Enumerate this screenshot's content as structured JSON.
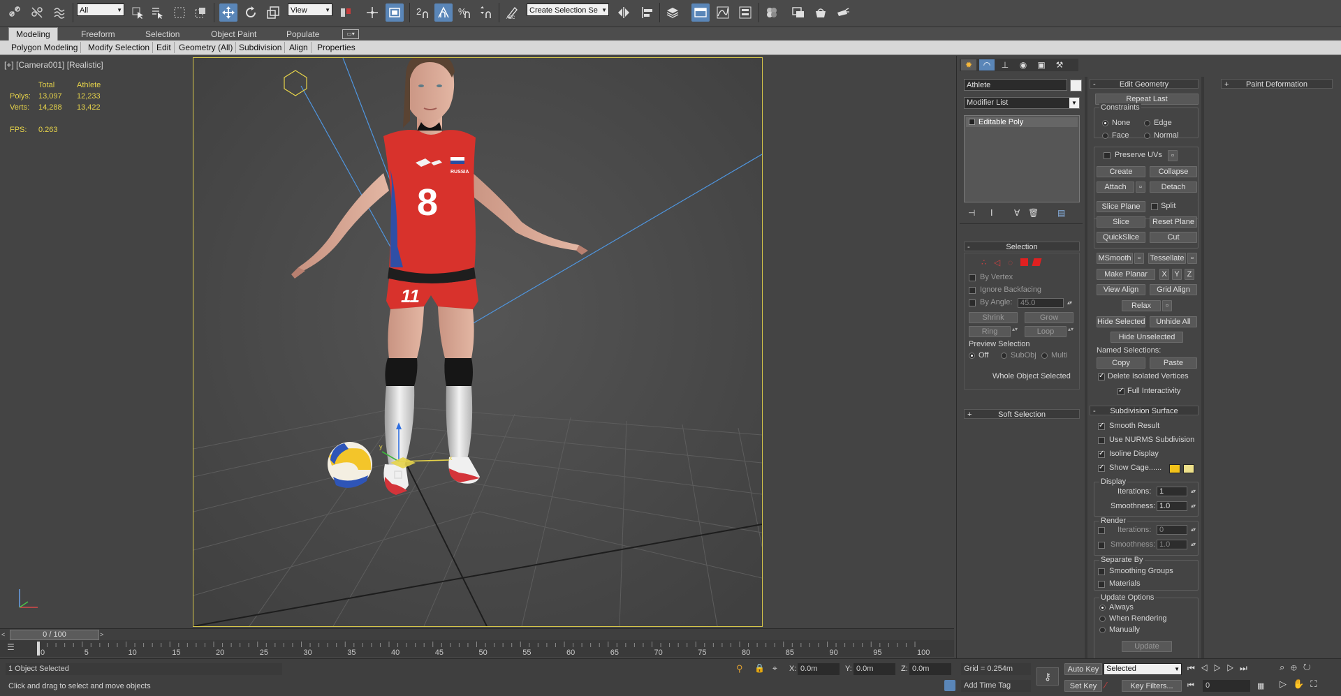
{
  "toolbar": {
    "selection_filter": "All",
    "ref_coord": "View",
    "named_selection_placeholder": "Create Selection Se",
    "snap_label": "2",
    "percent_snap": "%",
    "spinner_snap": "n"
  },
  "ribbon": {
    "tabs": [
      "Modeling",
      "Freeform",
      "Selection",
      "Object Paint",
      "Populate"
    ],
    "sub_tabs": [
      "Polygon Modeling",
      "Modify Selection",
      "Edit",
      "Geometry (All)",
      "Subdivision",
      "Align",
      "Properties"
    ]
  },
  "viewport": {
    "label": "[+] [Camera001] [Realistic]",
    "stats": {
      "col_total": "Total",
      "col_object": "Athlete",
      "polys_label": "Polys:",
      "polys_total": "13,097",
      "polys_object": "12,233",
      "verts_label": "Verts:",
      "verts_total": "14,288",
      "verts_object": "13,422",
      "fps_label": "FPS:",
      "fps_value": "0.263"
    },
    "jersey_text": "RUSSIA",
    "jersey_number": "8",
    "shorts_number": "11",
    "axis_x": "x",
    "axis_y": "y"
  },
  "command_panel": {
    "object_name": "Athlete",
    "modifier_list": "Modifier List",
    "stack_item": "Editable Poly",
    "selection": {
      "title": "Selection",
      "by_vertex": "By Vertex",
      "ignore_backfacing": "Ignore Backfacing",
      "by_angle": "By Angle:",
      "angle_value": "45.0",
      "shrink": "Shrink",
      "grow": "Grow",
      "ring": "Ring",
      "loop": "Loop",
      "preview_title": "Preview Selection",
      "preview_off": "Off",
      "preview_subobj": "SubObj",
      "preview_multi": "Multi",
      "status": "Whole Object Selected"
    },
    "soft_selection": "Soft Selection",
    "edit_geometry": {
      "title": "Edit Geometry",
      "repeat_last": "Repeat Last",
      "constraints": "Constraints",
      "c_none": "None",
      "c_edge": "Edge",
      "c_face": "Face",
      "c_normal": "Normal",
      "preserve_uvs": "Preserve UVs",
      "create": "Create",
      "collapse": "Collapse",
      "attach": "Attach",
      "detach": "Detach",
      "slice_plane": "Slice Plane",
      "split": "Split",
      "slice": "Slice",
      "reset_plane": "Reset Plane",
      "quickslice": "QuickSlice",
      "cut": "Cut",
      "msmooth": "MSmooth",
      "tessellate": "Tessellate",
      "make_planar": "Make Planar",
      "x": "X",
      "y": "Y",
      "z": "Z",
      "view_align": "View Align",
      "grid_align": "Grid Align",
      "relax": "Relax",
      "hide_selected": "Hide Selected",
      "unhide_all": "Unhide All",
      "hide_unselected": "Hide Unselected",
      "named_selections": "Named Selections:",
      "copy": "Copy",
      "paste": "Paste",
      "delete_isolated": "Delete Isolated Vertices",
      "full_interactivity": "Full Interactivity"
    },
    "subdivision": {
      "title": "Subdivision Surface",
      "smooth_result": "Smooth Result",
      "use_nurms": "Use NURMS Subdivision",
      "isoline": "Isoline Display",
      "show_cage": "Show Cage......",
      "cage_color_1": "#f2c21a",
      "cage_color_2": "#ede08a",
      "display": "Display",
      "iterations": "Iterations:",
      "iterations_val": "1",
      "smoothness": "Smoothness:",
      "smoothness_val": "1.0",
      "render": "Render",
      "r_iterations_val": "0",
      "r_smoothness_val": "1.0",
      "separate_by": "Separate By",
      "smoothing_groups": "Smoothing Groups",
      "materials": "Materials",
      "update_options": "Update Options",
      "always": "Always",
      "when_rendering": "When Rendering",
      "manually": "Manually",
      "update": "Update"
    },
    "paint_deformation": "Paint Deformation"
  },
  "timeline": {
    "frame": "0 / 100",
    "ticks": [
      "0",
      "5",
      "10",
      "15",
      "20",
      "25",
      "30",
      "35",
      "40",
      "45",
      "50",
      "55",
      "60",
      "65",
      "70",
      "75",
      "80",
      "85",
      "90",
      "95",
      "100"
    ]
  },
  "status": {
    "selected": "1 Object Selected",
    "prompt": "Click and drag to select and move objects",
    "x_label": "X:",
    "x_val": "0.0m",
    "y_label": "Y:",
    "y_val": "0.0m",
    "z_label": "Z:",
    "z_val": "0.0m",
    "grid": "Grid = 0.254m",
    "add_time_tag": "Add Time Tag",
    "auto_key": "Auto Key",
    "set_key": "Set Key",
    "key_mode": "Selected",
    "key_filters": "Key Filters...",
    "current_frame": "0"
  }
}
